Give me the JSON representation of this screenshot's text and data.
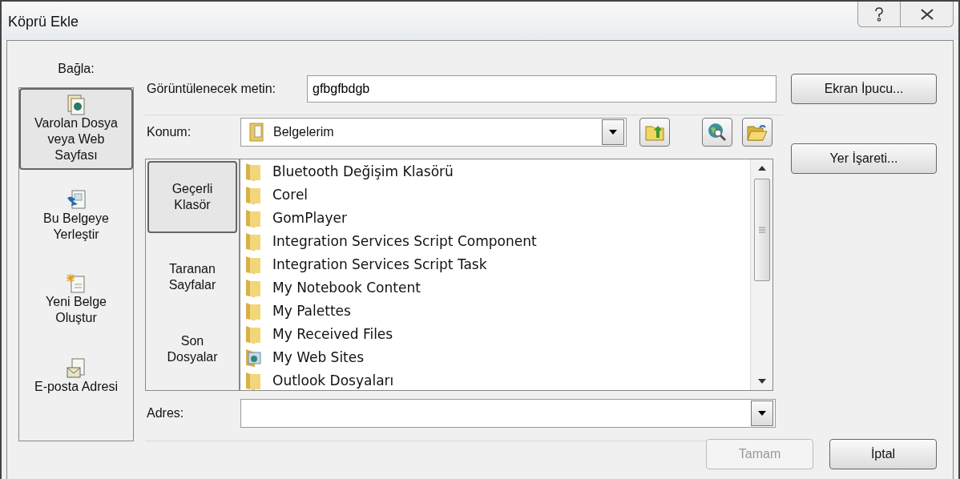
{
  "window": {
    "title": "Köprü Ekle"
  },
  "link_to": {
    "label": "Bağla:",
    "items": [
      {
        "kind": "existing",
        "label": "Varolan Dosya\nveya Web\nSayfası",
        "selected": true
      },
      {
        "kind": "place",
        "label": "Bu Belgeye\nYerleştir",
        "selected": false
      },
      {
        "kind": "new",
        "label": "Yeni Belge\nOluştur",
        "selected": false
      },
      {
        "kind": "email",
        "label": "E-posta Adresi",
        "selected": false
      }
    ]
  },
  "display_text": {
    "label": "Görüntülenecek metin:",
    "value": "gfbgfbdgb"
  },
  "screen_tip_button": "Ekran İpucu...",
  "location": {
    "label": "Konum:",
    "value": "Belgelerim"
  },
  "bookmark_button": "Yer İşareti...",
  "look_in_tabs": [
    {
      "label": "Geçerli\nKlasör",
      "selected": true
    },
    {
      "label": "Taranan\nSayfalar",
      "selected": false
    },
    {
      "label": "Son\nDosyalar",
      "selected": false
    }
  ],
  "files": [
    {
      "kind": "folder",
      "name": "Bluetooth Değişim Klasörü"
    },
    {
      "kind": "folder",
      "name": "Corel"
    },
    {
      "kind": "folder",
      "name": "GomPlayer"
    },
    {
      "kind": "folder",
      "name": "Integration Services Script Component"
    },
    {
      "kind": "folder",
      "name": "Integration Services Script Task"
    },
    {
      "kind": "folder",
      "name": "My Notebook Content"
    },
    {
      "kind": "folder",
      "name": "My Palettes"
    },
    {
      "kind": "folder",
      "name": "My Received Files"
    },
    {
      "kind": "web",
      "name": "My Web Sites"
    },
    {
      "kind": "folder",
      "name": "Outlook Dosyaları"
    }
  ],
  "address": {
    "label": "Adres:"
  },
  "buttons": [
    {
      "label": "Tamam",
      "disabled": true
    },
    {
      "label": "İptal",
      "disabled": false
    }
  ]
}
